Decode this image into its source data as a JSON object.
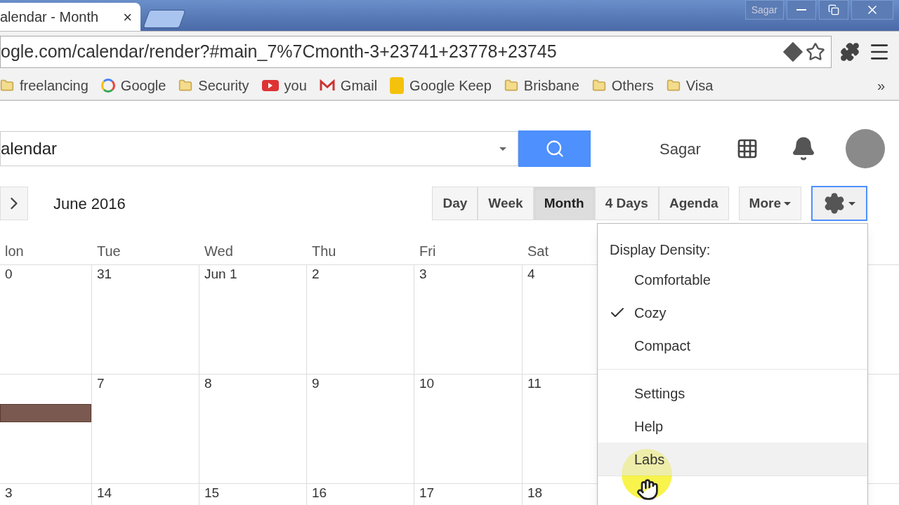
{
  "browser": {
    "tab_title": "alendar - Month",
    "tab_close": "×",
    "profile": "Sagar",
    "url": "ogle.com/calendar/render?#main_7%7Cmonth-3+23741+23778+23745",
    "bookmarks": [
      {
        "label": "freelancing",
        "kind": "folder"
      },
      {
        "label": "Google",
        "kind": "google"
      },
      {
        "label": "Security",
        "kind": "folder"
      },
      {
        "label": "you",
        "kind": "youtube"
      },
      {
        "label": "Gmail",
        "kind": "gmail"
      },
      {
        "label": "Google Keep",
        "kind": "keep"
      },
      {
        "label": "Brisbane",
        "kind": "folder"
      },
      {
        "label": "Others",
        "kind": "folder"
      },
      {
        "label": "Visa",
        "kind": "folder"
      }
    ],
    "bookmarks_more": "»"
  },
  "header": {
    "search_value": "alendar",
    "user": "Sagar"
  },
  "toolbar": {
    "period": "June 2016",
    "views": [
      {
        "label": "Day",
        "selected": false
      },
      {
        "label": "Week",
        "selected": false
      },
      {
        "label": "Month",
        "selected": true
      },
      {
        "label": "4 Days",
        "selected": false
      },
      {
        "label": "Agenda",
        "selected": false
      }
    ],
    "more": "More"
  },
  "calendar": {
    "weekdays": [
      "lon",
      "Tue",
      "Wed",
      "Thu",
      "Fri",
      "Sat"
    ],
    "weeks": [
      {
        "days": [
          {
            "number": "0"
          },
          {
            "number": "31"
          },
          {
            "number": "Jun 1"
          },
          {
            "number": "2"
          },
          {
            "number": "3"
          },
          {
            "number": "4"
          }
        ]
      },
      {
        "days": [
          {
            "event": true
          },
          {
            "number": "7"
          },
          {
            "number": "8"
          },
          {
            "number": "9"
          },
          {
            "number": "10"
          },
          {
            "number": "11"
          }
        ]
      },
      {
        "days": [
          {
            "number": "3"
          },
          {
            "number": "14"
          },
          {
            "number": "15"
          },
          {
            "number": "16"
          },
          {
            "number": "17"
          },
          {
            "number": "18"
          }
        ]
      }
    ]
  },
  "settings_menu": {
    "heading": "Display Density:",
    "density": [
      {
        "label": "Comfortable",
        "checked": false
      },
      {
        "label": "Cozy",
        "checked": true
      },
      {
        "label": "Compact",
        "checked": false
      }
    ],
    "items": [
      {
        "label": "Settings",
        "selected": false
      },
      {
        "label": "Help",
        "selected": false
      },
      {
        "label": "Labs",
        "selected": true
      }
    ]
  }
}
